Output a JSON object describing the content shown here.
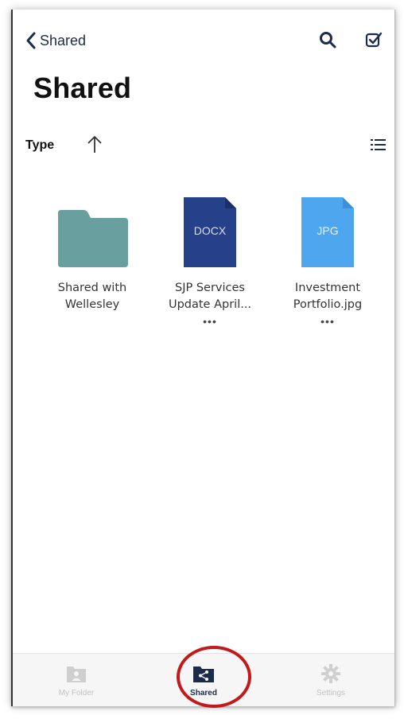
{
  "header": {
    "back_label": "Shared",
    "title": "Shared",
    "icons": [
      "search-icon",
      "select-checkbox-icon"
    ]
  },
  "toolbar": {
    "sort_label": "Type",
    "sort_direction_icon": "arrow-up-icon",
    "view_icon": "list-view-icon"
  },
  "items": [
    {
      "name_line1": "Shared with",
      "name_line2": "Wellesley",
      "kind": "folder",
      "badge": "",
      "color": "#6a9fa0"
    },
    {
      "name_line1": "SJP Services",
      "name_line2": "Update April...",
      "kind": "file",
      "badge": "DOCX",
      "color": "#26418a",
      "more": "•••"
    },
    {
      "name_line1": "Investment",
      "name_line2": "Portfolio.jpg",
      "kind": "file",
      "badge": "JPG",
      "color": "#4da6ee",
      "more": "•••"
    }
  ],
  "tabs": [
    {
      "label": "My Folder",
      "icon": "folder-person-icon",
      "active": false
    },
    {
      "label": "Shared",
      "icon": "shared-folder-icon",
      "active": true
    },
    {
      "label": "Settings",
      "icon": "gear-icon",
      "active": false
    }
  ],
  "colors": {
    "accent": "#1b2b4b",
    "highlight": "#c01a1a",
    "folder": "#6a9fa0",
    "docx": "#26418a",
    "jpg": "#4da6ee"
  }
}
